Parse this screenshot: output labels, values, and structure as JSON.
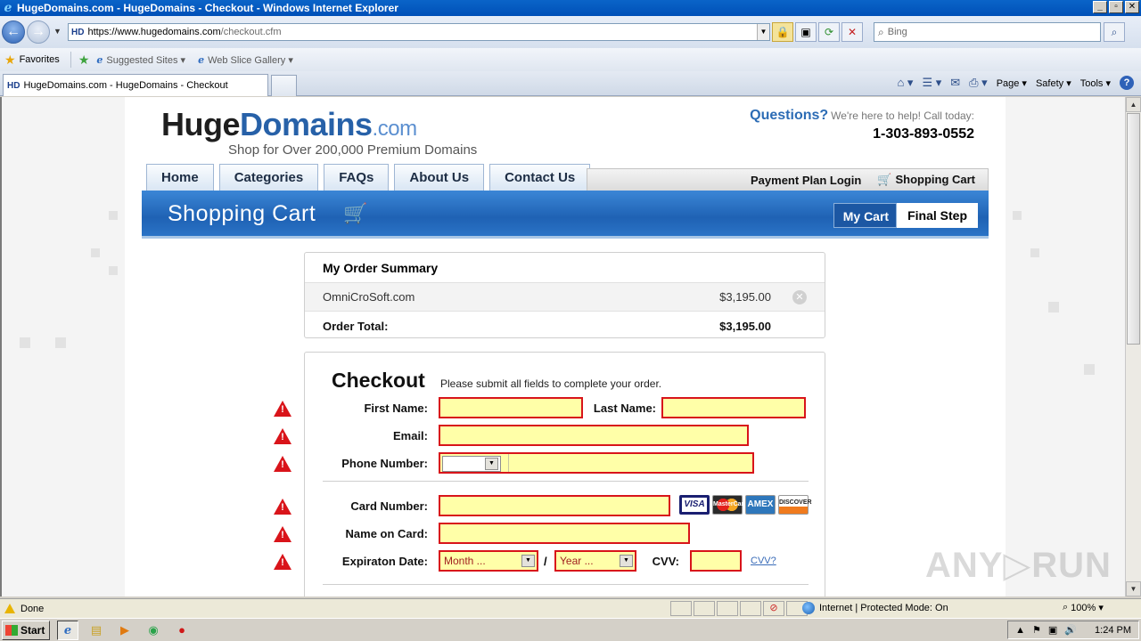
{
  "window": {
    "title": "HugeDomains.com - HugeDomains - Checkout - Windows Internet Explorer",
    "controls": [
      "_",
      "▫",
      "✕"
    ]
  },
  "browser": {
    "address": {
      "site_icon": "HD",
      "url_host": "https://www.hugedomains.com",
      "url_rest": "/checkout.cfm"
    },
    "search": {
      "placeholder": "Bing"
    },
    "favorites": {
      "label": "Favorites",
      "items": [
        "Suggested Sites ▾",
        "Web Slice Gallery ▾"
      ]
    },
    "tab": {
      "icon": "HD",
      "label": "HugeDomains.com - HugeDomains - Checkout"
    },
    "commands": {
      "page": "Page ▾",
      "safety": "Safety ▾",
      "tools": "Tools ▾",
      "help": "?"
    }
  },
  "site": {
    "logo": {
      "huge": "Huge",
      "domains": "Domains",
      "com": ".com",
      "tagline": "Shop for Over 200,000 Premium Domains"
    },
    "contact": {
      "questions": "Questions?",
      "help_text": "We're here to help! Call today:",
      "phone": "1-303-893-0552"
    },
    "nav": [
      "Home",
      "Categories",
      "FAQs",
      "About Us",
      "Contact Us"
    ],
    "subnav": {
      "payment_plan": "Payment Plan Login",
      "cart": "Shopping Cart"
    },
    "banner": {
      "title": "Shopping Cart",
      "step1": "My Cart",
      "step2": "Final Step"
    }
  },
  "order_summary": {
    "title": "My Order Summary",
    "items": [
      {
        "name": "OmniCroSoft.com",
        "price": "$3,195.00"
      }
    ],
    "total_label": "Order Total:",
    "total_value": "$3,195.00"
  },
  "checkout": {
    "title": "Checkout",
    "subtitle": "Please submit all fields to complete your order.",
    "labels": {
      "first_name": "First Name:",
      "last_name": "Last Name:",
      "email": "Email:",
      "phone": "Phone Number:",
      "card_number": "Card Number:",
      "name_on_card": "Name on Card:",
      "expiration": "Expiraton Date:",
      "cvv": "CVV:"
    },
    "month_placeholder": "Month ...",
    "year_placeholder": "Year ...",
    "slash": "/",
    "cvv_link": "CVV?",
    "cards": [
      "VISA",
      "MasterCard",
      "AMEX",
      "DISCOVER"
    ]
  },
  "watermark": "ANY▷RUN",
  "status": {
    "text": "Done",
    "zone": "Internet | Protected Mode: On",
    "zoom": "100%"
  },
  "taskbar": {
    "start": "Start",
    "clock": "1:24 PM"
  },
  "colors": {
    "error_border": "#d8141a",
    "field_bg": "#ffffa8",
    "brand_blue": "#2761a8",
    "banner_blue": "#1f62b4"
  }
}
